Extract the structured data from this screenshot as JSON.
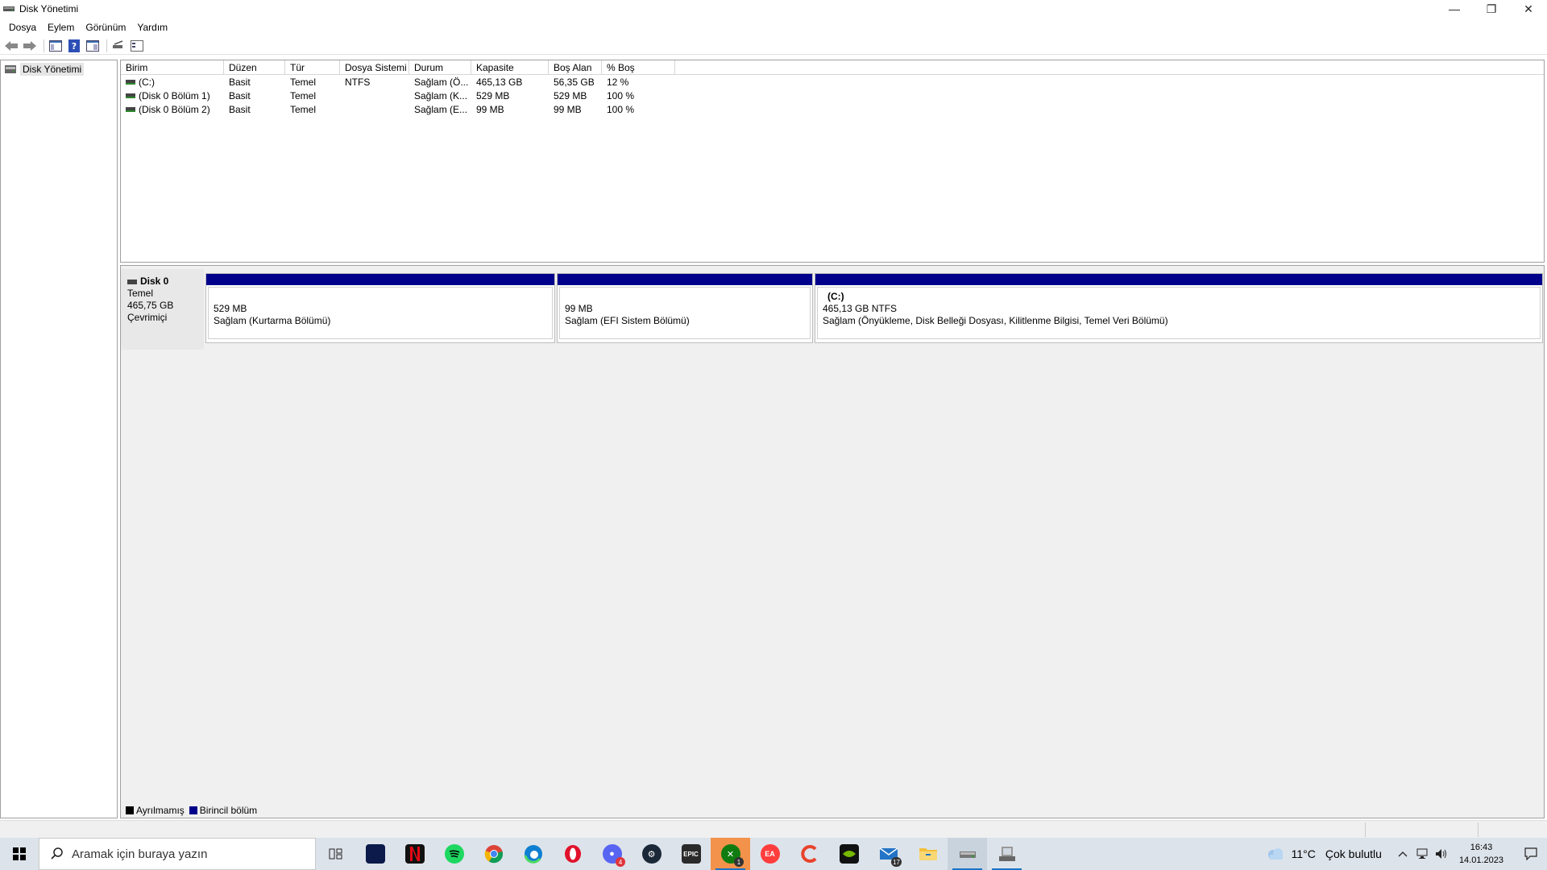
{
  "window": {
    "title": "Disk Yönetimi",
    "min": "—",
    "restore": "❐",
    "close": "✕"
  },
  "menu": [
    "Dosya",
    "Eylem",
    "Görünüm",
    "Yardım"
  ],
  "tree": {
    "root": "Disk Yönetimi"
  },
  "list": {
    "headers": [
      "Birim",
      "Düzen",
      "Tür",
      "Dosya Sistemi",
      "Durum",
      "Kapasite",
      "Boş Alan",
      "% Boş"
    ],
    "rows": [
      {
        "volume": "(C:)",
        "layout": "Basit",
        "type": "Temel",
        "fs": "NTFS",
        "status": "Sağlam (Ö...",
        "capacity": "465,13 GB",
        "free": "56,35 GB",
        "pct": "12 %"
      },
      {
        "volume": "(Disk 0 Bölüm 1)",
        "layout": "Basit",
        "type": "Temel",
        "fs": "",
        "status": "Sağlam (K...",
        "capacity": "529 MB",
        "free": "529 MB",
        "pct": "100 %"
      },
      {
        "volume": "(Disk 0 Bölüm 2)",
        "layout": "Basit",
        "type": "Temel",
        "fs": "",
        "status": "Sağlam (E...",
        "capacity": "99 MB",
        "free": "99 MB",
        "pct": "100 %"
      }
    ]
  },
  "disk": {
    "name": "Disk 0",
    "type": "Temel",
    "size": "465,75 GB",
    "state": "Çevrimiçi",
    "partitions": [
      {
        "label": "",
        "size": "529 MB",
        "status": "Sağlam (Kurtarma Bölümü)"
      },
      {
        "label": "",
        "size": "99 MB",
        "status": "Sağlam (EFI Sistem Bölümü)"
      },
      {
        "label": "(C:)",
        "size": "465,13 GB NTFS",
        "status": "Sağlam (Önyükleme, Disk Belleği Dosyası, Kilitlenme Bilgisi, Temel Veri Bölümü)"
      }
    ]
  },
  "legend": {
    "unallocated": "Ayrılmamış",
    "primary": "Birincil bölüm",
    "unallocated_color": "#000000",
    "primary_color": "#00008b"
  },
  "taskbar": {
    "search_placeholder": "Aramak için buraya yazın",
    "icons": [
      "task-view",
      "disney-plus",
      "netflix",
      "spotify",
      "chrome",
      "edge",
      "opera",
      "discord",
      "steam",
      "epic-games",
      "xbox",
      "ea",
      "ccleaner",
      "nvidia",
      "mail",
      "file-explorer",
      "disk-management",
      "computer-management"
    ],
    "xbox_badge": "1",
    "mail_badge": "17",
    "epic_label": "EPIC",
    "ea_label": "EA",
    "weather": {
      "temp": "11°C",
      "desc": "Çok bulutlu"
    },
    "clock": {
      "time": "16:43",
      "date": "14.01.2023"
    }
  }
}
